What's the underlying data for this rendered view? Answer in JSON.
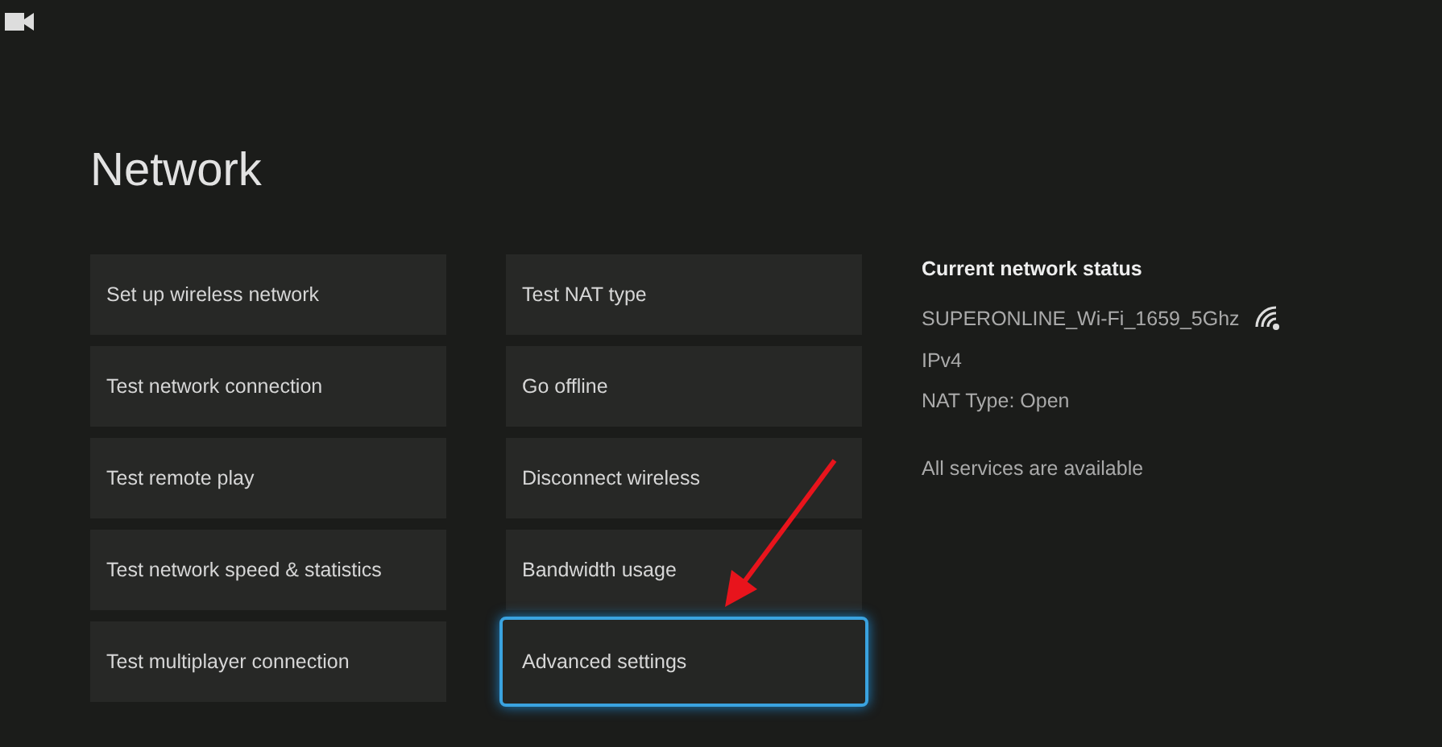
{
  "title": "Network",
  "columns": [
    [
      {
        "label": "Set up wireless network",
        "selected": false
      },
      {
        "label": "Test network connection",
        "selected": false
      },
      {
        "label": "Test remote play",
        "selected": false
      },
      {
        "label": "Test network speed & statistics",
        "selected": false
      },
      {
        "label": "Test multiplayer connection",
        "selected": false
      }
    ],
    [
      {
        "label": "Test NAT type",
        "selected": false
      },
      {
        "label": "Go offline",
        "selected": false
      },
      {
        "label": "Disconnect wireless",
        "selected": false
      },
      {
        "label": "Bandwidth usage",
        "selected": false
      },
      {
        "label": "Advanced settings",
        "selected": true
      }
    ]
  ],
  "status": {
    "heading": "Current network status",
    "network_name": "SUPERONLINE_Wi-Fi_1659_5Ghz",
    "protocol": "IPv4",
    "nat_type": "NAT Type: Open",
    "services": "All services are available"
  }
}
